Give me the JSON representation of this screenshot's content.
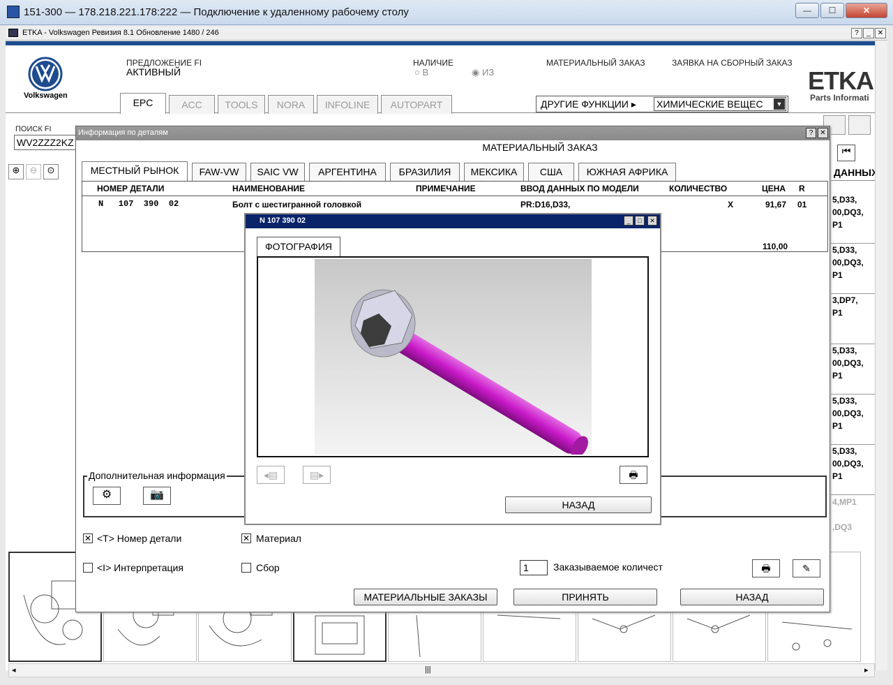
{
  "rdp": {
    "title": "151-300 — 178.218.221.178:222 — Подключение к удаленному рабочему столу",
    "min": "—",
    "max": "☐",
    "close": "✕"
  },
  "etka": {
    "title": "ETKA - Volkswagen Ревизия 8.1 Обновление 1480 / 246",
    "help": "?",
    "min": "_",
    "close": "✕"
  },
  "header": {
    "brand": "Volkswagen",
    "offer_label": "ПРЕДЛОЖЕНИЕ FI",
    "offer_value": "АКТИВНЫЙ",
    "availability_label": "НАЛИЧИЕ",
    "opt_in": "В",
    "opt_from": "ИЗ",
    "material_order": "МАТЕРИАЛЬНЫЙ ЗАКАЗ",
    "assembly_order": "ЗАЯВКА НА СБОРНЫЙ ЗАКАЗ",
    "etka_logo": "ETKA",
    "etka_sub": "Parts Informati",
    "other_functions": "ДРУГИЕ ФУНКЦИИ",
    "chemicals": "ХИМИЧЕСКИЕ ВЕЩЕС",
    "search_label": "ПОИСК FI",
    "search_value": "WV2ZZZ2KZ"
  },
  "main_tabs": [
    "EPC",
    "ACC",
    "TOOLS",
    "NORA",
    "INFOLINE",
    "AUTOPART"
  ],
  "right_col": {
    "header": "ДАННЫХ",
    "rows": [
      [
        "5,D33,",
        "00,DQ3,",
        "P1"
      ],
      [
        "5,D33,",
        "00,DQ3,",
        "P1"
      ],
      [
        "3,DP7,",
        "P1"
      ],
      [
        "5,D33,",
        "00,DQ3,",
        "P1"
      ],
      [
        "5,D33,",
        "00,DQ3,",
        "P1"
      ],
      [
        "5,D33,",
        "00,DQ3,",
        "P1"
      ],
      [
        "4,MP1"
      ],
      [
        ",DQ3"
      ]
    ]
  },
  "dialog": {
    "title": "Информация по деталям",
    "heading": "МАТЕРИАЛЬНЫЙ ЗАКАЗ",
    "help": "?",
    "close": "✕",
    "tabs": [
      "МЕСТНЫЙ РЫНОК",
      "FAW-VW",
      "SAIC VW",
      "АРГЕНТИНА",
      "БРАЗИЛИЯ",
      "МЕКСИКА",
      "США",
      "ЮЖНАЯ АФРИКА"
    ],
    "columns": [
      "НОМЕР ДЕТАЛИ",
      "НАИМЕНОВАНИЕ",
      "ПРИМЕЧАНИЕ",
      "ВВОД ДАННЫХ ПО МОДЕЛИ",
      "КОЛИЧЕСТВО",
      "ЦЕНА",
      "R"
    ],
    "row": {
      "part": "N   107  390  02",
      "name": "Болт с шестигранной головкой",
      "model": "PR:D16,D33,",
      "qty": "X",
      "price": "91,67",
      "r": "01"
    },
    "total": "110,00",
    "extra_info": "Дополнительная информация",
    "cb_part": "<T> Номер детали",
    "cb_material": "Материал",
    "cb_interp": "<I> Интерпретация",
    "cb_assembly": "Сбор",
    "qty_value": "1",
    "qty_label": "Заказываемое количест",
    "btn_orders": "МАТЕРИАЛЬНЫЕ ЗАКАЗЫ",
    "btn_accept": "ПРИНЯТЬ",
    "btn_back": "НАЗАД"
  },
  "photo": {
    "title": "N  107 390 02",
    "tab": "ФОТОГРАФИЯ",
    "back": "НАЗАД",
    "min": "_",
    "max": "□",
    "close": "✕"
  },
  "bottom": {
    "labels": [
      "",
      "",
      "",
      "",
      "",
      "",
      "",
      "",
      ""
    ]
  }
}
